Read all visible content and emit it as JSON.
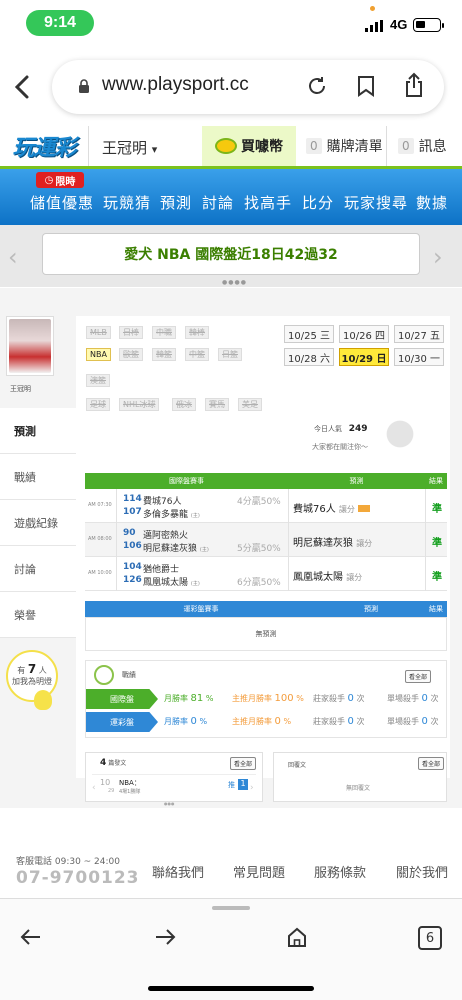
{
  "status_bar": {
    "time": "9:14",
    "network": "4G"
  },
  "browser": {
    "url": "www.playsport.cc",
    "tabs_count": "6"
  },
  "header": {
    "logo_text": "玩運彩",
    "username": "王冠明",
    "username_caret": "▾",
    "buy_coin": "買噱幣",
    "cart_count": "0",
    "cart_label": "購牌清單",
    "msg_count": "0",
    "msg_label": "訊息"
  },
  "nav": {
    "limited_badge": "限時",
    "items": [
      "儲值優惠",
      "玩競猜",
      "預測",
      "討論",
      "找高手",
      "比分",
      "玩家搜尋",
      "數據"
    ]
  },
  "ticker": {
    "text": "愛犬 NBA 國際盤近18日42過32",
    "prev": "‹",
    "next": "›",
    "dots": "●●●●"
  },
  "profile": {
    "avatar_name": "王冠明",
    "side_tabs": [
      "預測",
      "戰績",
      "遊戲紀錄",
      "討論",
      "榮譽"
    ],
    "follow_prefix": "有",
    "follow_count": "7",
    "follow_unit": "人",
    "follow_suffix": "加我為明燈"
  },
  "leagues": {
    "row1": [
      "MLB",
      "日棒",
      "中職",
      "韓棒"
    ],
    "row2": [
      "NBA",
      "歐籃",
      "韓籃",
      "中籃",
      "日籃"
    ],
    "row3": [
      "澳籃"
    ],
    "row4": [
      "足球",
      "NHL冰球",
      "俄冰",
      "賽馬",
      "美足"
    ]
  },
  "dates": {
    "row1": [
      "10/25 三",
      "10/26 四",
      "10/27 五"
    ],
    "row2": [
      "10/28 六",
      "10/29 日",
      "10/30 一"
    ]
  },
  "popularity": {
    "label": "今日人氣",
    "value": "249",
    "follow_text": "大家都在關注你～"
  },
  "intl_table": {
    "header_game": "國際盤賽事",
    "header_pick": "預測",
    "header_result": "結果",
    "rows": [
      {
        "time": "AM 07:30",
        "n1": "114",
        "t1": "費城76人",
        "n2": "107",
        "t2": "多倫多暴龍",
        "mark": "(主)",
        "handicap": "4分贏50%",
        "pick": "費城76人",
        "pick_sub": "讓分",
        "result": "準"
      },
      {
        "time": "AM 08:00",
        "n1": "90",
        "t1": "邁阿密熱火",
        "n2": "106",
        "t2": "明尼蘇達灰狼",
        "mark": "(主)",
        "handicap": "5分贏50%",
        "pick": "明尼蘇達灰狼",
        "pick_sub": "讓分",
        "result": "準"
      },
      {
        "time": "AM 10:00",
        "n1": "104",
        "t1": "猶他爵士",
        "n2": "126",
        "t2": "鳳凰城太陽",
        "mark": "(主)",
        "handicap": "6分贏50%",
        "pick": "鳳凰城太陽",
        "pick_sub": "讓分",
        "result": "準"
      }
    ]
  },
  "sport_table": {
    "header_game": "運彩盤賽事",
    "header_pick": "預測",
    "header_result": "結果",
    "empty": "無預測"
  },
  "stats": {
    "label": "戰績",
    "see_all": "看全部",
    "intl": {
      "tag": "國際盤",
      "win_label": "月勝率",
      "win": "81",
      "home_label": "主推月勝率",
      "home": "100",
      "pct": "%",
      "a_label": "莊家殺手",
      "a": "0",
      "b_label": "單場殺手",
      "b": "0",
      "unit": "次"
    },
    "sport": {
      "tag": "運彩盤",
      "win_label": "月勝率",
      "win": "0",
      "home_label": "主推月勝率",
      "home": "0",
      "pct": "%",
      "a_label": "莊家殺手",
      "a": "0",
      "b_label": "單場殺手",
      "b": "0",
      "unit": "次"
    }
  },
  "posts": {
    "count": "4",
    "title": "篇發文",
    "see_all": "看全部",
    "day": "10",
    "date": "29",
    "post_title": "NBA：",
    "post_sub": "4場1勝隊",
    "push_label": "推",
    "push_count": "1",
    "reply_title": "回覆文",
    "reply_see_all": "看全部",
    "reply_empty": "無回覆文",
    "dots": "●●●"
  },
  "footer": {
    "service_label": "客服電話 09:30 ~ 24:00",
    "phone": "07-9700123",
    "links": [
      "聯絡我們",
      "常見問題",
      "服務條款",
      "關於我們"
    ]
  },
  "colors": {
    "nav_blue": "#1a86d8",
    "green_accent": "#7cc21e",
    "orange": "#f39c3c"
  }
}
